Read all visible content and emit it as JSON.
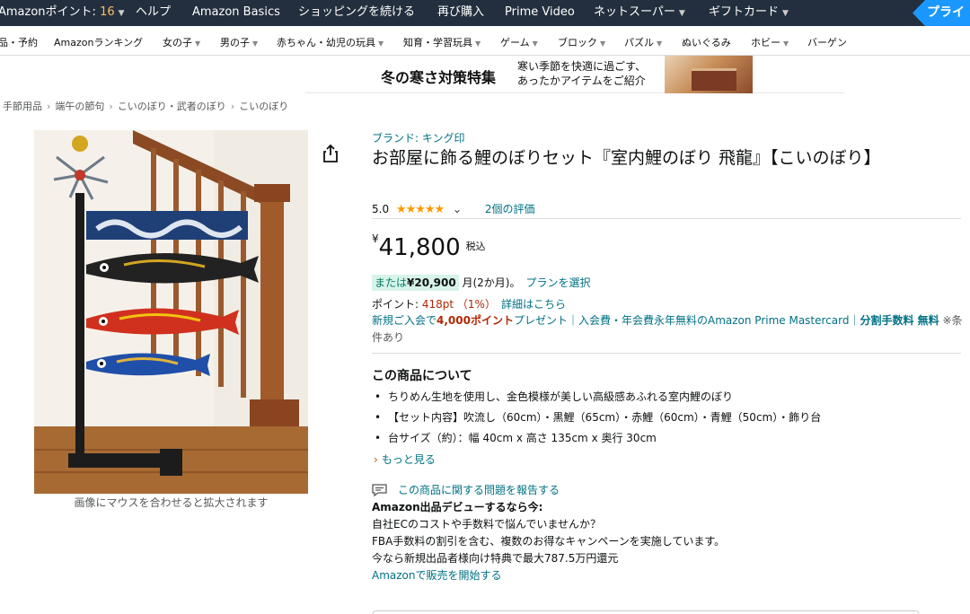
{
  "top_nav": {
    "points_label": "Amazonポイント: ",
    "points_value": "16",
    "items": [
      "ヘルプ",
      "Amazon Basics",
      "ショッピングを続ける",
      "再び購入",
      "Prime Video",
      "ネットスーパー",
      "ギフトカード"
    ],
    "prime_label": "プライ"
  },
  "category_nav": {
    "items": [
      "品・予約",
      "Amazonランキング",
      "女の子",
      "男の子",
      "赤ちゃん・幼児の玩具",
      "知育・学習玩具",
      "ゲーム",
      "ブロック",
      "パズル",
      "ぬいぐるみ",
      "ホビー",
      "バーゲン"
    ]
  },
  "banner": {
    "title": "冬の寒さ対策特集",
    "subtitle": "寒い季節を快適に過ごす、\nあったかアイテムをご紹介"
  },
  "breadcrumb": [
    "手節用品",
    "端午の節句",
    "こいのぼり・武者のぼり",
    "こいのぼり"
  ],
  "image": {
    "caption": "画像にマウスを合わせると拡大されます"
  },
  "product": {
    "brand": "ブランド: キング印",
    "title": "お部屋に飾る鯉のぼりセット『室内鯉のぼり 飛龍』【こいのぼり】",
    "rating_score": "5.0",
    "stars": "★★★★★",
    "rating_value": 5,
    "reviews": "2個の評価",
    "price_symbol": "¥",
    "price": "41,800",
    "tax_label": "税込",
    "installment_prefix": "または",
    "installment_amount": "¥20,900",
    "installment_suffix": " 月(2か月)。",
    "plan_link": "プランを選択",
    "points_label": "ポイント: ",
    "points_value": "418pt （1%）",
    "points_link": "詳細はこちら",
    "promo_1": "新規ご入会で",
    "promo_points": "4,000ポイント",
    "promo_2": "プレゼント｜入会費・年会費永年無料のAmazon Prime Mastercard｜",
    "promo_3": "分割手数料 無料",
    "promo_cond": " ※条件あり"
  },
  "about": {
    "heading": "この商品について",
    "bullets": [
      "ちりめん生地を使用し、金色模様が美しい高級感あふれる室内鯉のぼり",
      "【セット内容】吹流し（60cm）・黒鯉（65cm）・赤鯉（60cm）・青鯉（50cm）・飾り台",
      "台サイズ（約）：幅 40cm x 高さ 135cm x 奥行 30cm"
    ],
    "more": "もっと見る"
  },
  "report_link": "この商品に関する問題を報告する",
  "seller": {
    "heading": "Amazon出品デビューするなら今:",
    "line1": "自社ECのコストや手数料で悩んでいませんか？",
    "line2": "FBA手数料の割引を含む、複数のお得なキャンペーンを実施しています。",
    "line3": "今なら新規出品者様向け特典で最大787.5万円還元",
    "cta": "Amazonで販売を開始する"
  },
  "colors": {
    "nav_bg": "#232f3e",
    "link": "#007185",
    "price_accent": "#b12704",
    "star": "#ff9900",
    "prime": "#1a98ff"
  }
}
